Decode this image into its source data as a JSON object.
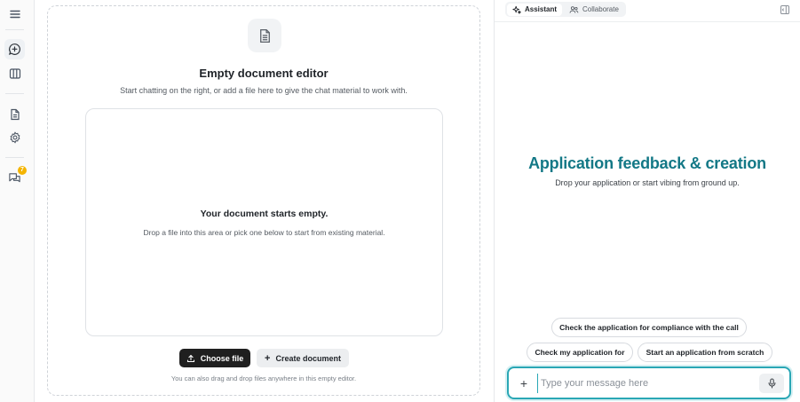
{
  "rail": {
    "icons": [
      "menu-icon",
      "new-chat-icon",
      "columns-icon",
      "document-icon",
      "settings-icon",
      "messages-icon"
    ],
    "badge": "7"
  },
  "editor": {
    "title": "Empty document editor",
    "subtitle": "Start chatting on the right, or add a file here to give the chat material to work with.",
    "drop_title": "Your document starts empty.",
    "drop_subtitle": "Drop a file into this area or pick one below to start from existing material.",
    "choose_file_label": "Choose file",
    "create_document_label": "Create document",
    "hint": "You can also drag and drop files anywhere in this empty editor."
  },
  "chat": {
    "tabs": [
      {
        "label": "Assistant",
        "icon": "sparkle-icon",
        "active": true
      },
      {
        "label": "Collaborate",
        "icon": "users-icon",
        "active": false
      }
    ],
    "hero_title": "Application feedback & creation",
    "hero_subtitle": "Drop your application or start vibing from ground up.",
    "suggestions": [
      "Check the application for compliance with the call",
      "Check my application for",
      "Start an application from scratch"
    ],
    "input": {
      "placeholder": "Type your message here",
      "value": ""
    }
  },
  "colors": {
    "accent": "#137886",
    "input_border": "#2aa7b5",
    "badge": "#f4b400",
    "primary_button": "#1f1f1f"
  }
}
